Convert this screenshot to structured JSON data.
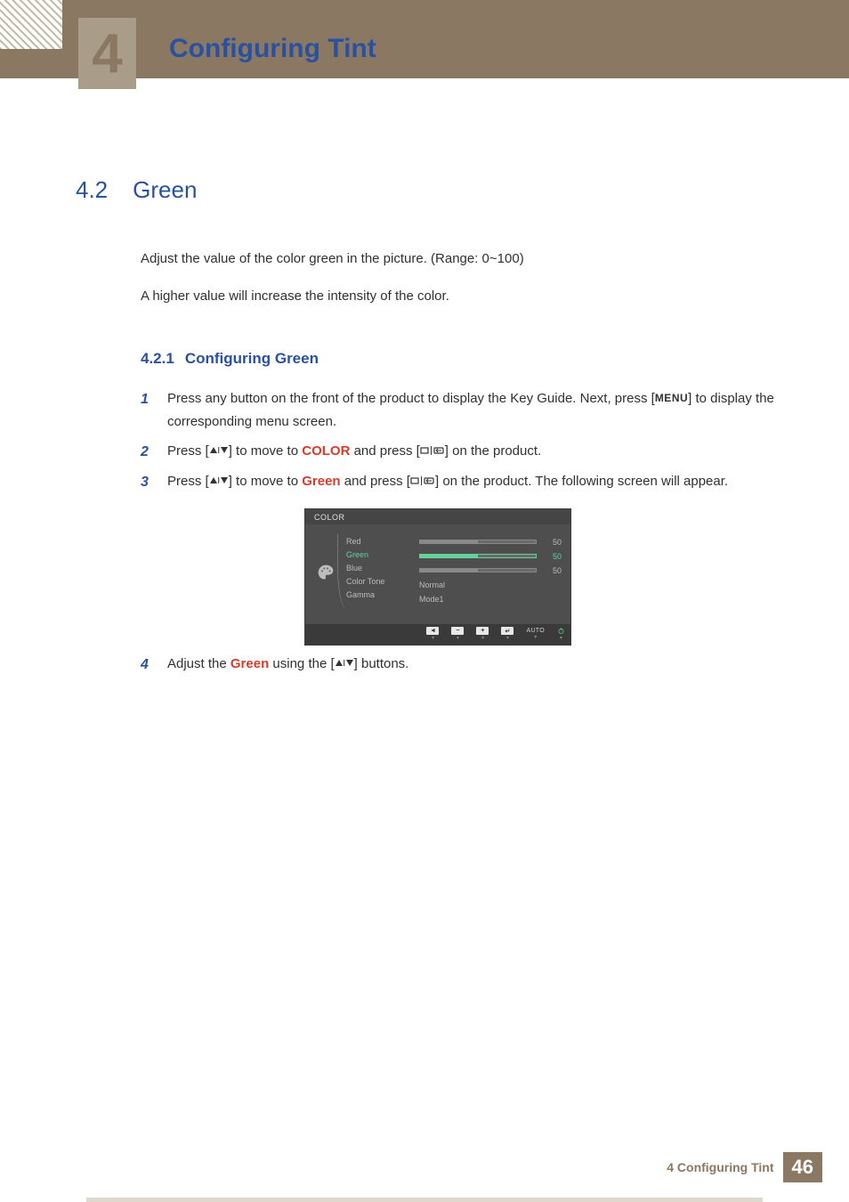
{
  "header": {
    "chapter_number": "4",
    "chapter_title": "Configuring Tint"
  },
  "section": {
    "number": "4.2",
    "title": "Green",
    "intro1": "Adjust the value of the color green in the picture. (Range: 0~100)",
    "intro2": "A higher value will increase the intensity of the color."
  },
  "subsection": {
    "number": "4.2.1",
    "title": "Configuring Green"
  },
  "steps": {
    "s1_a": "Press any button on the front of the product to display the Key Guide. Next, press [",
    "menu": "MENU",
    "s1_b": "] to display the corresponding menu screen.",
    "s2_a": "Press [",
    "s2_b": "] to move to ",
    "color_kw": "COLOR",
    "s2_c": " and press [",
    "s2_d": "] on the product.",
    "s3_a": "Press [",
    "s3_b": "] to move to ",
    "green_kw": "Green",
    "s3_c": " and press [",
    "s3_d": "] on the product. The following screen will appear.",
    "s4_a": "Adjust the ",
    "s4_b": " using the [",
    "s4_c": "] buttons."
  },
  "osd": {
    "title": "COLOR",
    "rows": [
      {
        "label": "Red",
        "type": "slider",
        "value": 50,
        "selected": false
      },
      {
        "label": "Green",
        "type": "slider",
        "value": 50,
        "selected": true
      },
      {
        "label": "Blue",
        "type": "slider",
        "value": 50,
        "selected": false
      },
      {
        "label": "Color Tone",
        "type": "text",
        "value": "Normal"
      },
      {
        "label": "Gamma",
        "type": "text",
        "value": "Mode1"
      }
    ],
    "footer_auto": "AUTO"
  },
  "footer": {
    "text": "4 Configuring Tint",
    "page": "46"
  }
}
